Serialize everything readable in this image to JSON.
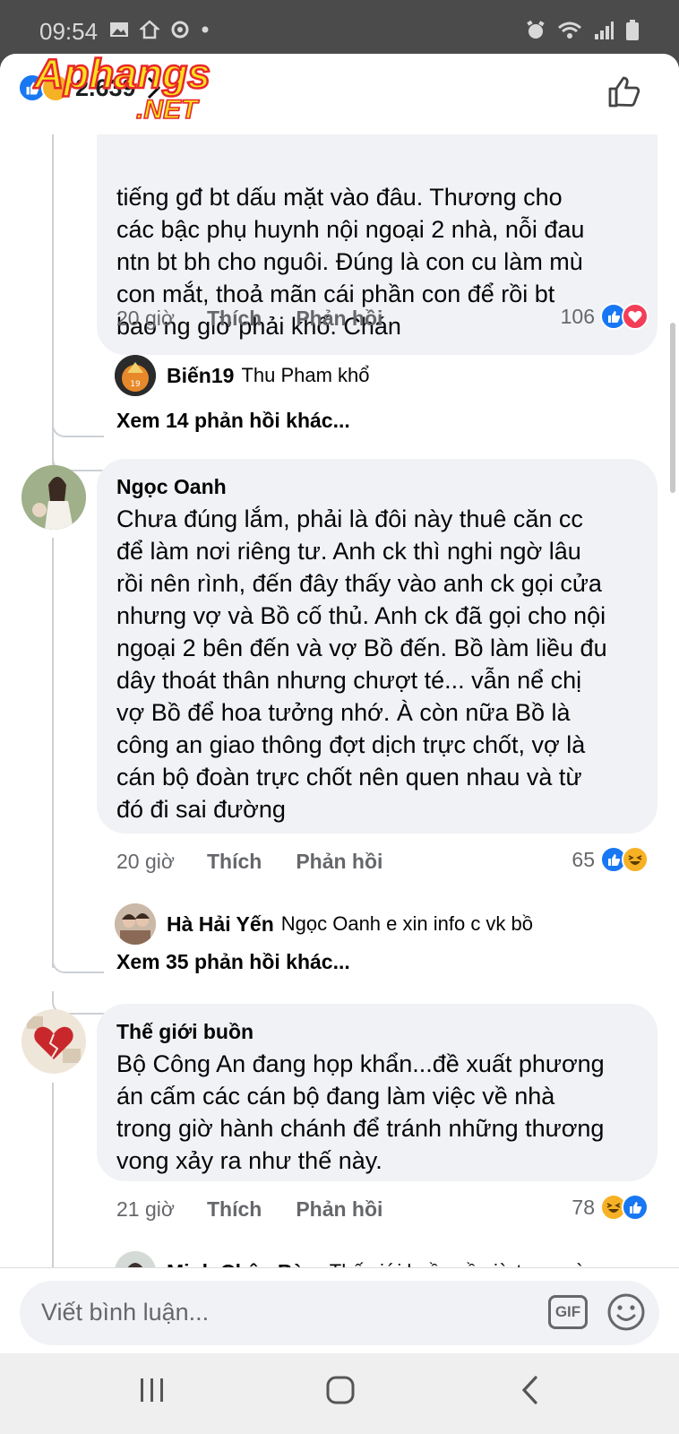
{
  "status_bar": {
    "time": "09:54"
  },
  "header": {
    "reaction_count": "2.639",
    "watermark_text": "Aphangs .NET"
  },
  "comments": [
    {
      "text": "tiếng gđ bt dấu mặt vào đâu. Thương cho\ncác bậc phụ huynh nội ngoại 2 nhà, nỗi đau\nntn bt bh cho nguôi. Đúng là con cu làm mù\ncon mắt, thoả mãn cái phần con để rồi bt\nbao ng giờ phải khổ. Chán",
      "time": "20 giờ",
      "like_label": "Thích",
      "reply_label": "Phản hồi",
      "reaction_count": "106",
      "reply": {
        "name": "Biến19",
        "text": "Thu Pham khổ"
      },
      "more_replies": "Xem 14 phản hồi khác..."
    },
    {
      "author": "Ngọc Oanh",
      "text": "Chưa đúng lắm, phải là đôi này thuê căn cc\nđể làm nơi riêng tư. Anh ck thì nghi ngờ lâu\nrồi nên rình, đến đây thấy vào anh ck gọi cửa\nnhưng vợ và Bồ cố thủ. Anh ck đã gọi cho nội\nngoại 2 bên đến và vợ Bồ đến. Bồ làm liều đu\ndây thoát thân nhưng chượt té... vẫn nể chị\nvợ Bồ để hoa tưởng nhớ. À còn nữa Bồ là\ncông an giao thông đợt dịch trực chốt, vợ là\ncán bộ đoàn trực chốt nên quen nhau và từ\nđó đi sai đường",
      "time": "20 giờ",
      "like_label": "Thích",
      "reply_label": "Phản hồi",
      "reaction_count": "65",
      "reply": {
        "name": "Hà Hải Yến",
        "text": "Ngọc Oanh e xin info c vk bồ"
      },
      "more_replies": "Xem 35 phản hồi khác..."
    },
    {
      "author": "Thế giới buồn",
      "text": "Bộ Công An đang họp khẩn...đề xuất phương\nán cấm các cán bộ đang làm việc về nhà\ntrong giờ hành chánh để tránh những thương\nvong xảy ra như thế này.",
      "time": "21 giờ",
      "like_label": "Thích",
      "reply_label": "Phản hồi",
      "reaction_count": "78",
      "reply": {
        "name": "Minh Châu Bàm",
        "text": "Thế giới buồn về giờ trưa mà"
      }
    }
  ],
  "composer": {
    "placeholder": "Viết bình luận...",
    "gif_label": "GIF"
  },
  "colors": {
    "like_blue": "#1877f2",
    "love_red": "#f33e58",
    "haha_yellow": "#f7b125",
    "bubble_bg": "#f0f2f5"
  }
}
